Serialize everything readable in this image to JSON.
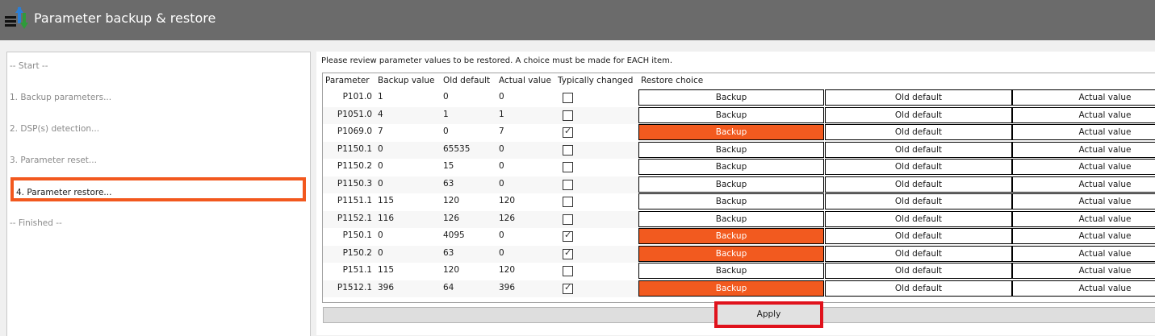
{
  "window": {
    "title": "Parameter backup & restore",
    "titlebar_color": "#6b6b6b",
    "icon": "parameter-backup-icon"
  },
  "sidebar": {
    "steps": [
      {
        "label": "-- Start --",
        "state": "done"
      },
      {
        "label": "1. Backup parameters...",
        "state": "done"
      },
      {
        "label": "2. DSP(s) detection...",
        "state": "done"
      },
      {
        "label": "3. Parameter reset...",
        "state": "done"
      },
      {
        "label": "4. Parameter restore...",
        "state": "active"
      },
      {
        "label": "-- Finished --",
        "state": "pending"
      }
    ],
    "active_highlight_color": "#f2581e"
  },
  "main": {
    "instruction": "Please review parameter values to be restored. A choice must be made for EACH item.",
    "columns": [
      "Parameter",
      "Backup value",
      "Old default",
      "Actual value",
      "Typically changed",
      "Restore choice"
    ],
    "choice_labels": {
      "backup": "Backup",
      "old_default": "Old default",
      "actual_value": "Actual value"
    },
    "selected_color": "#f25a1f",
    "rows": [
      {
        "parameter": "P101.0",
        "backup": "1",
        "old_default": "0",
        "actual": "0",
        "typically_changed": false,
        "choice": ""
      },
      {
        "parameter": "P1051.0",
        "backup": "4",
        "old_default": "1",
        "actual": "1",
        "typically_changed": false,
        "choice": ""
      },
      {
        "parameter": "P1069.0",
        "backup": "7",
        "old_default": "0",
        "actual": "7",
        "typically_changed": true,
        "choice": "backup"
      },
      {
        "parameter": "P1150.1",
        "backup": "0",
        "old_default": "65535",
        "actual": "0",
        "typically_changed": false,
        "choice": ""
      },
      {
        "parameter": "P1150.2",
        "backup": "0",
        "old_default": "15",
        "actual": "0",
        "typically_changed": false,
        "choice": ""
      },
      {
        "parameter": "P1150.3",
        "backup": "0",
        "old_default": "63",
        "actual": "0",
        "typically_changed": false,
        "choice": ""
      },
      {
        "parameter": "P1151.1",
        "backup": "115",
        "old_default": "120",
        "actual": "120",
        "typically_changed": false,
        "choice": ""
      },
      {
        "parameter": "P1152.1",
        "backup": "116",
        "old_default": "126",
        "actual": "126",
        "typically_changed": false,
        "choice": ""
      },
      {
        "parameter": "P150.1",
        "backup": "0",
        "old_default": "4095",
        "actual": "0",
        "typically_changed": true,
        "choice": "backup"
      },
      {
        "parameter": "P150.2",
        "backup": "0",
        "old_default": "63",
        "actual": "0",
        "typically_changed": true,
        "choice": "backup"
      },
      {
        "parameter": "P151.1",
        "backup": "115",
        "old_default": "120",
        "actual": "120",
        "typically_changed": false,
        "choice": ""
      },
      {
        "parameter": "P1512.1",
        "backup": "396",
        "old_default": "64",
        "actual": "396",
        "typically_changed": true,
        "choice": "backup"
      }
    ]
  },
  "footer": {
    "apply_label": "Apply",
    "apply_highlight_color": "#e0121c"
  }
}
